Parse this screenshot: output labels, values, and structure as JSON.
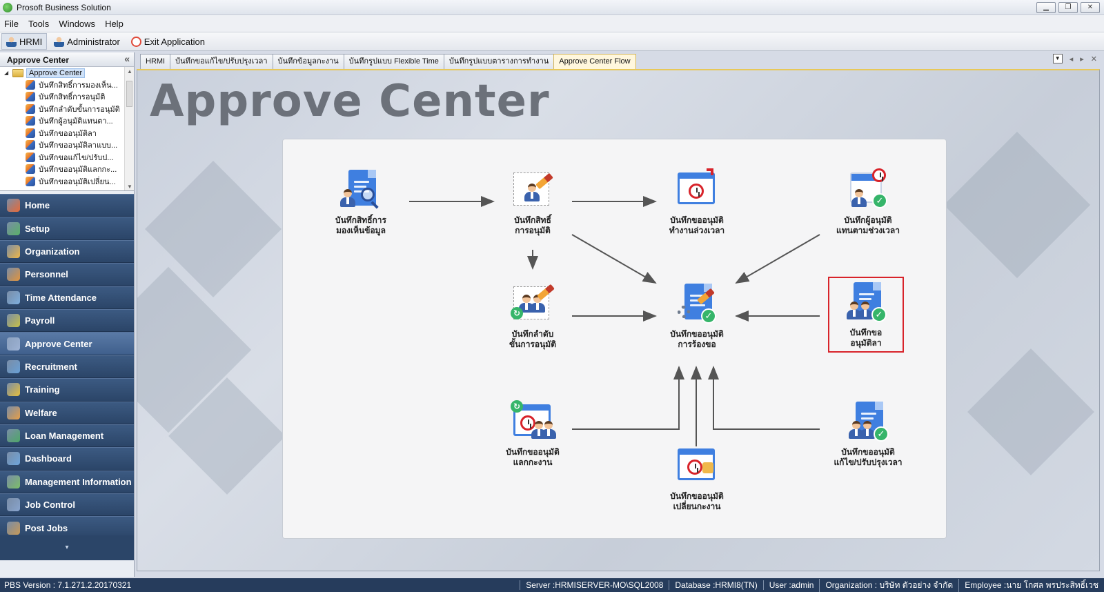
{
  "window": {
    "title": "Prosoft Business Solution",
    "min": "▁",
    "restore": "❐",
    "close": "✕"
  },
  "menu": [
    "File",
    "Tools",
    "Windows",
    "Help"
  ],
  "toolbar": {
    "hrmi": "HRMI",
    "admin": "Administrator",
    "exit": "Exit Application"
  },
  "left_panel": {
    "title": "Approve Center",
    "tree_root": "Approve Center",
    "tree_items": [
      "บันทึกสิทธิ์การมองเห็น...",
      "บันทึกสิทธิ์การอนุมัติ",
      "บันทึกลำดับขั้นการอนุมัติ",
      "บันทึกผู้อนุมัติแทนตา...",
      "บันทึกขออนุมัติลา",
      "บันทึกขออนุมัติลาแบบ...",
      "บันทึกขอแก้ไข/ปรับป...",
      "บันทึกขออนุมัติแลกกะ...",
      "บันทึกขออนุมัติเปลี่ยน..."
    ],
    "nav": [
      {
        "label": "Home",
        "color": "#e86b3a"
      },
      {
        "label": "Setup",
        "color": "#5bb26a"
      },
      {
        "label": "Organization",
        "color": "#f0b84a"
      },
      {
        "label": "Personnel",
        "color": "#e2953f"
      },
      {
        "label": "Time Attendance",
        "color": "#7fb0e0"
      },
      {
        "label": "Payroll",
        "color": "#c8c24a"
      },
      {
        "label": "Approve Center",
        "color": "#9fb4d6"
      },
      {
        "label": "Recruitment",
        "color": "#6aa1d8"
      },
      {
        "label": "Training",
        "color": "#e6c03f"
      },
      {
        "label": "Welfare",
        "color": "#e8a04a"
      },
      {
        "label": "Loan Management",
        "color": "#4fa86a"
      },
      {
        "label": "Dashboard",
        "color": "#6fa7de"
      },
      {
        "label": "Management Information",
        "color": "#7ec06a"
      },
      {
        "label": "Job Control",
        "color": "#8aa6d0"
      },
      {
        "label": "Post Jobs",
        "color": "#c79a5a"
      }
    ]
  },
  "tabs": [
    "HRMI",
    "บันทึกขอแก้ไข/ปรับปรุงเวลา",
    "บันทึกข้อมูลกะงาน",
    "บันทึกรูปแบบ Flexible Time",
    "บันทึกรูปแบบตารางการทำงาน",
    "Approve Center Flow"
  ],
  "content": {
    "heading": "Approve Center",
    "nodes": {
      "view_rights": [
        "บันทึกสิทธิ์การ",
        "มองเห็นข้อมูล"
      ],
      "approve_rights": [
        "บันทึกสิทธิ์",
        "การอนุมัติ"
      ],
      "overtime": [
        "บันทึกขออนุมัติ",
        "ทำงานล่วงเวลา"
      ],
      "substitute": [
        "บันทึกผู้อนุมัติ",
        "แทนตามช่วงเวลา"
      ],
      "approval_steps": [
        "บันทึกลำดับ",
        "ขั้นการอนุมัติ"
      ],
      "request": [
        "บันทึกขออนุมัติ",
        "การร้องขอ"
      ],
      "leave": [
        "บันทึกขอ",
        "อนุมัติลา"
      ],
      "swap_shift": [
        "บันทึกขออนุมัติ",
        "แลกกะงาน"
      ],
      "change_shift": [
        "บันทึกขออนุมัติ",
        "เปลี่ยนกะงาน"
      ],
      "adjust_time": [
        "บันทึกขออนุมัติ",
        "แก้ไข/ปรับปรุงเวลา"
      ]
    }
  },
  "status": {
    "version": "PBS Version : 7.1.271.2.20170321",
    "server": "Server :HRMISERVER-MO\\SQL2008",
    "database": "Database :HRMI8(TN)",
    "user": "User :admin",
    "organization": "Organization : บริษัท ตัวอย่าง จำกัด",
    "employee": "Employee :นาย โกศล พรประสิทธิ์เวช"
  }
}
